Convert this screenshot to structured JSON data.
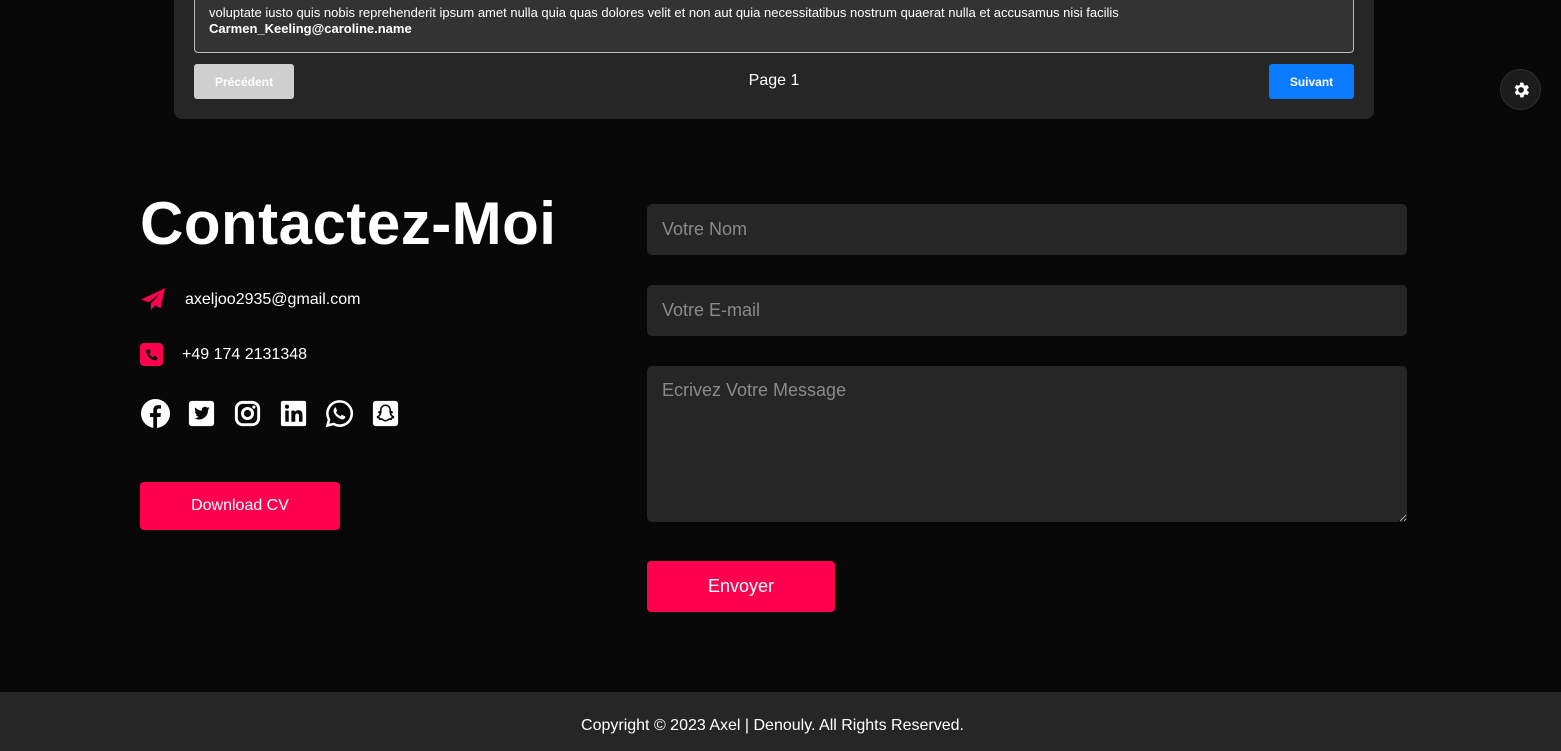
{
  "comments": {
    "text": "voluptate iusto quis nobis reprehenderit ipsum amet nulla quia quas dolores velit et non aut quia necessitatibus nostrum quaerat nulla et accusamus nisi facilis",
    "email": "Carmen_Keeling@caroline.name",
    "prev_label": "Précédent",
    "page_label": "Page 1",
    "next_label": "Suivant"
  },
  "theme_toggle": {
    "icon": "gear-icon"
  },
  "contact": {
    "title": "Contactez-Moi",
    "email": "axeljoo2935@gmail.com",
    "phone": "+49 174 2131348",
    "socials": [
      "facebook-icon",
      "twitter-icon",
      "instagram-icon",
      "linkedin-icon",
      "whatsapp-icon",
      "snapchat-icon"
    ],
    "cv_label": "Download CV"
  },
  "form": {
    "name_placeholder": "Votre Nom",
    "email_placeholder": "Votre E-mail",
    "message_placeholder": "Ecrivez Votre Message",
    "submit_label": "Envoyer"
  },
  "footer": {
    "copyright": "Copyright © 2023 Axel | Denouly. All Rights Reserved."
  },
  "colors": {
    "accent": "#ff004f",
    "primary_button": "#0a7bff",
    "background": "#080808",
    "panel": "#262626"
  }
}
